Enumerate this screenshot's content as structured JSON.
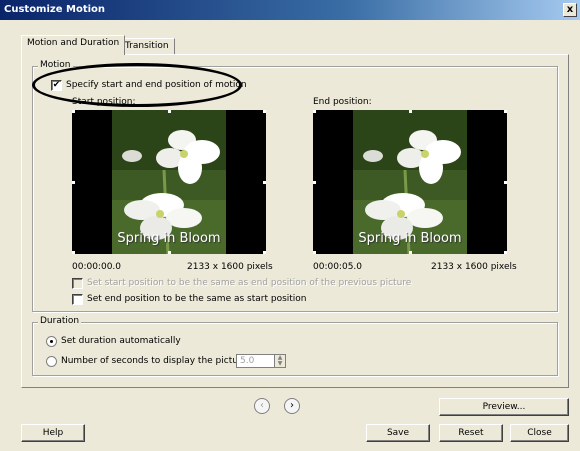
{
  "window": {
    "title": "Customize Motion",
    "close_glyph": "x"
  },
  "tabs": [
    {
      "label": "Motion and Duration",
      "active": true
    },
    {
      "label": "Transition",
      "active": false
    }
  ],
  "motion_group": {
    "legend": "Motion",
    "specify_checkbox": {
      "label": "Specify start and end position of motion",
      "checked": true
    },
    "start": {
      "label": "Start position:",
      "time": "00:00:00.0",
      "size": "2133 x 1600 pixels",
      "caption": "Spring in Bloom"
    },
    "end": {
      "label": "End position:",
      "time": "00:00:05.0",
      "size": "2133 x 1600 pixels",
      "caption": "Spring in Bloom"
    },
    "set_start_checkbox": {
      "label": "Set start position to be the same as end position of the previous picture",
      "checked": false,
      "enabled": false
    },
    "set_end_checkbox": {
      "label": "Set end position to be the same as start position",
      "checked": false,
      "enabled": true
    }
  },
  "duration_group": {
    "legend": "Duration",
    "auto_radio": {
      "label": "Set duration automatically",
      "selected": true
    },
    "seconds_radio": {
      "label": "Number of seconds to display the picture",
      "selected": false
    },
    "seconds_value": "5.0"
  },
  "nav": {
    "prev_glyph": "‹",
    "next_glyph": "›"
  },
  "buttons": {
    "preview": "Preview...",
    "help": "Help",
    "save": "Save",
    "reset": "Reset",
    "close": "Close"
  }
}
